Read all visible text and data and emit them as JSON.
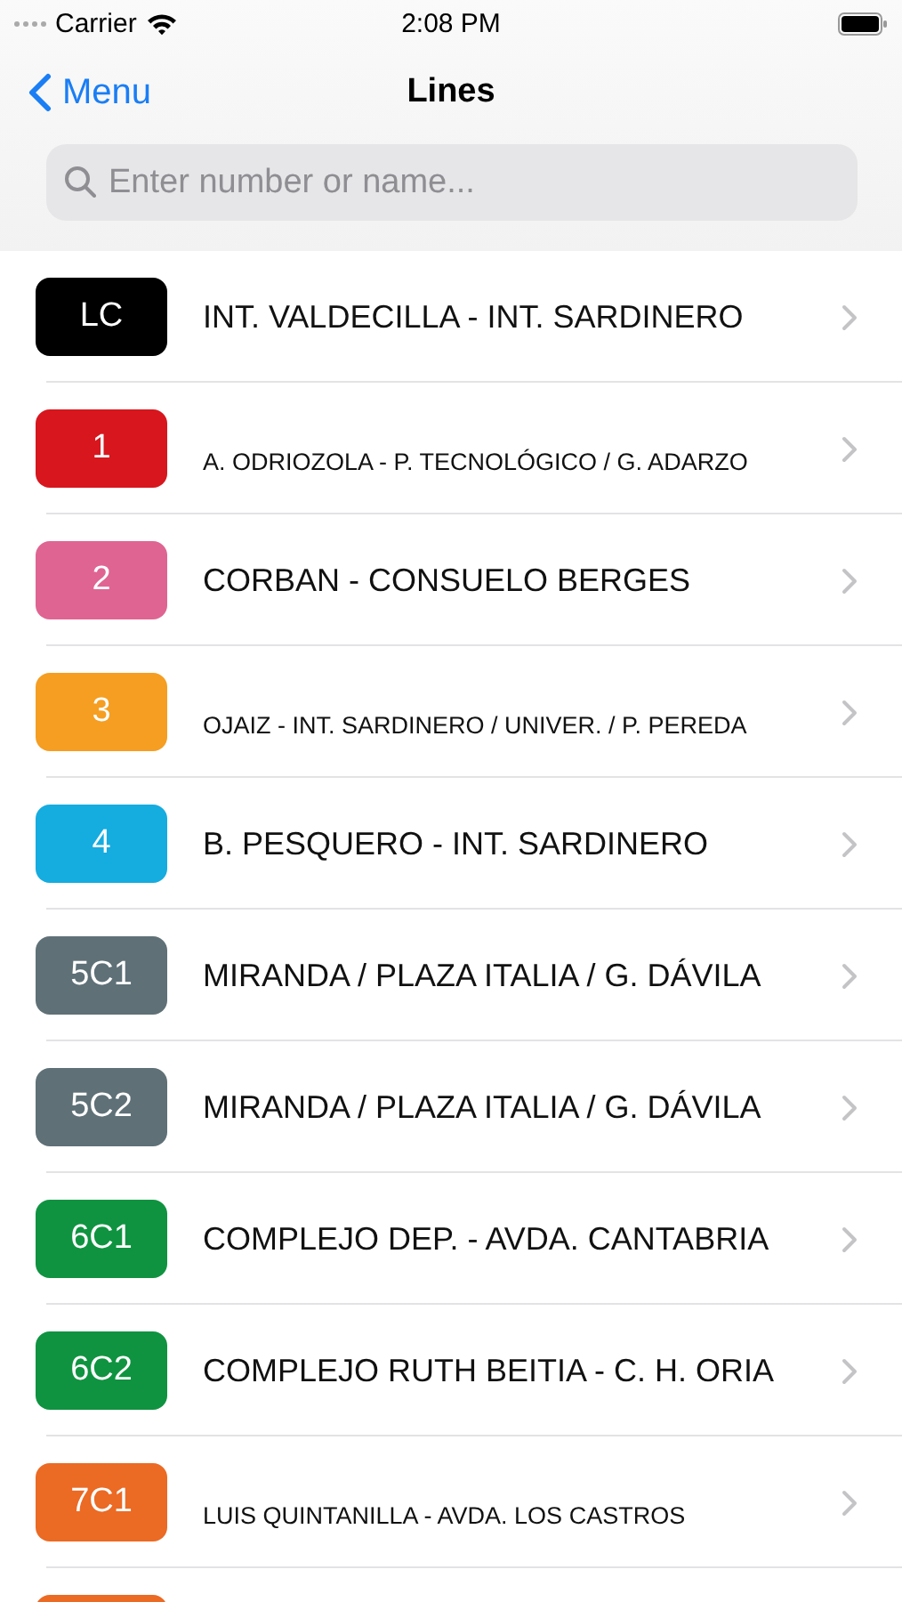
{
  "status_bar": {
    "carrier": "Carrier",
    "time": "2:08 PM"
  },
  "nav": {
    "back": "Menu",
    "title": "Lines"
  },
  "search": {
    "placeholder": "Enter number or name..."
  },
  "lines": [
    {
      "code": "LC",
      "name": "INT. VALDECILLA - INT. SARDINERO",
      "color": "#000000",
      "compact": false
    },
    {
      "code": "1",
      "name": "A. ODRIOZOLA - P. TECNOLÓGICO / G. ADARZO",
      "color": "#d7161e",
      "compact": true
    },
    {
      "code": "2",
      "name": "CORBAN - CONSUELO BERGES",
      "color": "#df6492",
      "compact": false
    },
    {
      "code": "3",
      "name": "OJAIZ - INT. SARDINERO / UNIVER. / P. PEREDA",
      "color": "#f59e22",
      "compact": true
    },
    {
      "code": "4",
      "name": "B. PESQUERO - INT. SARDINERO",
      "color": "#15ace0",
      "compact": false
    },
    {
      "code": "5C1",
      "name": "MIRANDA / PLAZA ITALIA / G. DÁVILA",
      "color": "#5f7077",
      "compact": false
    },
    {
      "code": "5C2",
      "name": "MIRANDA / PLAZA ITALIA / G. DÁVILA",
      "color": "#5f7077",
      "compact": false
    },
    {
      "code": "6C1",
      "name": "COMPLEJO DEP. - AVDA. CANTABRIA",
      "color": "#0f9340",
      "compact": false
    },
    {
      "code": "6C2",
      "name": "COMPLEJO RUTH BEITIA - C. H. ORIA",
      "color": "#0f9340",
      "compact": false
    },
    {
      "code": "7C1",
      "name": "LUIS QUINTANILLA - AVDA. LOS CASTROS",
      "color": "#eb6a24",
      "compact": true
    },
    {
      "color": "#eb6a24"
    }
  ]
}
